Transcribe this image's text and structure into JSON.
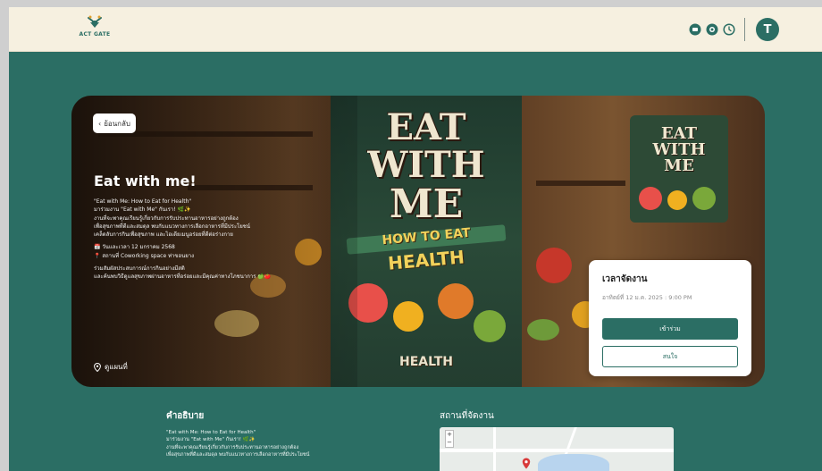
{
  "topbar": {
    "logo_text": "ACT GATE",
    "avatar_letter": "T",
    "icons": [
      "chat-icon",
      "badge-icon",
      "clock-icon"
    ]
  },
  "hero": {
    "back_label": "ย้อนกลับ",
    "title": "Eat with me!",
    "description": [
      "\"Eat with Me: How to Eat for Health\"\nมาร่วมงาน \"Eat with Me\" กันเรา! 🌿✨\nงานที่จะพาคุณเรียนรู้เกี่ยวกับการรับประทานอาหารอย่างถูกต้อง\nเพื่อสุขภาพที่ดีและสมดุล พบกับแนวทางการเลือกอาหารที่มีประโยชน์\nเคล็ดลับการกินเพื่อสุขภาพ และไอเดียเมนูอร่อยที่ดีต่อร่างกาย",
      "📅 วันและเวลา 12 มกราคม 2568\n📍 สถานที่ Coworking space ท่าขอนยาง",
      "ร่วมสัมผัสประสบการณ์การกินอย่างมีสติ\nและค้นพบวิธีดูแลสุขภาพผ่านอาหารที่อร่อยและมีคุณค่าทางโภชนาการ 🍏🍅"
    ],
    "map_link": "ดูแผนที่",
    "poster": {
      "line1": "EAT",
      "line2": "WITH",
      "line3": "ME",
      "sub1": "HOW TO EAT",
      "sub2": "HEALTH",
      "sub3": "HEALTH"
    },
    "mini_poster": {
      "line1": "EAT",
      "line2": "WITH",
      "line3": "ME"
    }
  },
  "event_card": {
    "title": "เวลาจัดงาน",
    "datetime": "อาทิตย์ที่ 12 ม.ค. 2025 : 9:00 PM",
    "join_label": "เข้าร่วม",
    "interest_label": "สนใจ"
  },
  "description_section": {
    "heading": "คำอธิบาย",
    "lines": [
      "\"Eat with Me: How to Eat for Health\"",
      "มาร่วมงาน \"Eat with Me\" กันเรา! 🌿✨",
      "งานที่จะพาคุณเรียนรู้เกี่ยวกับการรับประทานอาหารอย่างถูกต้อง",
      "เพื่อสุขภาพที่ดีและสมดุล พบกับแนวทางการเลือกอาหารที่มีประโยชน์"
    ]
  },
  "place_section": {
    "heading": "สถานที่จัดงาน",
    "zoom_in": "+",
    "zoom_out": "−"
  },
  "colors": {
    "primary": "#2b6e64",
    "topbar_bg": "#f6f0e0",
    "card_bg": "#ffffff"
  }
}
